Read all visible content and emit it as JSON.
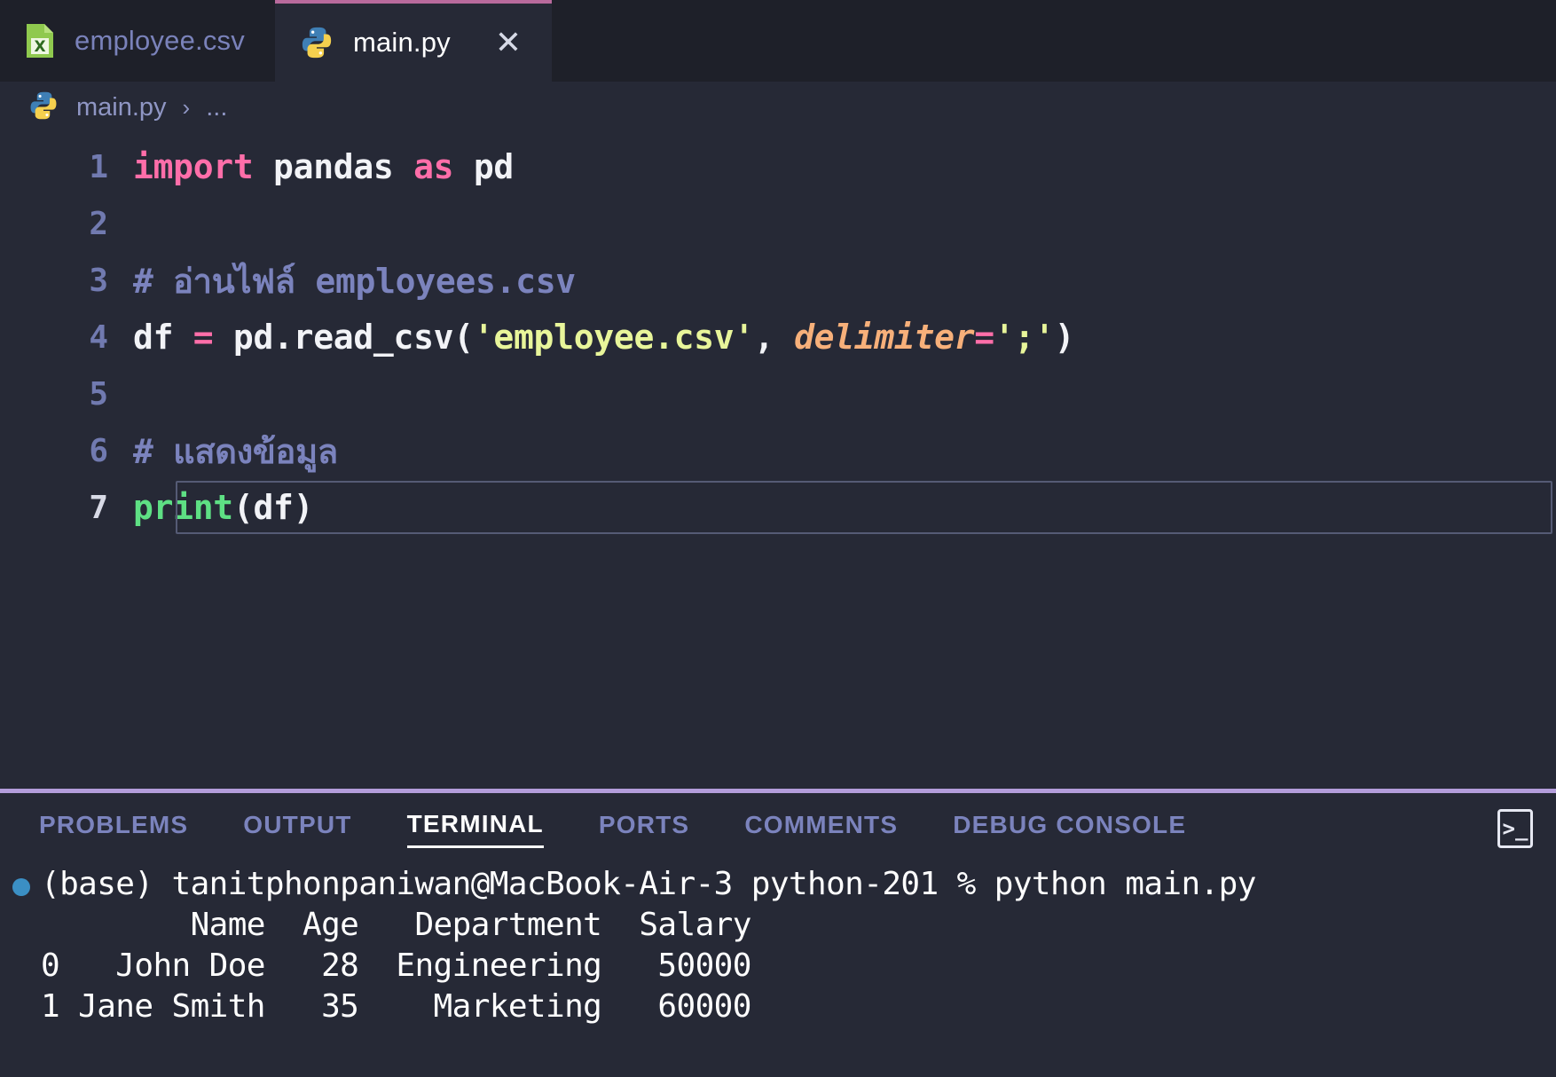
{
  "window": {
    "accent_active_tab": "#b86a9c",
    "panel_border": "#b39ddb",
    "editor_bg": "#262936",
    "tabbar_bg": "#1e2029"
  },
  "tabs": [
    {
      "label": "employee.csv",
      "icon": "csv-file-icon",
      "active": false,
      "closable": false
    },
    {
      "label": "main.py",
      "icon": "python-file-icon",
      "active": true,
      "closable": true,
      "close_glyph": "✕"
    }
  ],
  "breadcrumb": {
    "icon": "python-file-icon",
    "file": "main.py",
    "separator": "›",
    "overflow": "..."
  },
  "editor": {
    "lines": [
      {
        "number": "1",
        "current": false,
        "tokens": [
          {
            "text": "import",
            "type": "kw"
          },
          {
            "text": " pandas ",
            "type": "plain"
          },
          {
            "text": "as",
            "type": "kw"
          },
          {
            "text": " pd",
            "type": "plain"
          }
        ]
      },
      {
        "number": "2",
        "current": false,
        "tokens": []
      },
      {
        "number": "3",
        "current": false,
        "tokens": [
          {
            "text": "# อ่านไฟล์ employees.csv",
            "type": "comment"
          }
        ]
      },
      {
        "number": "4",
        "current": false,
        "tokens": [
          {
            "text": "df ",
            "type": "plain"
          },
          {
            "text": "=",
            "type": "op"
          },
          {
            "text": " pd.read_csv(",
            "type": "plain"
          },
          {
            "text": "'employee.csv'",
            "type": "string"
          },
          {
            "text": ", ",
            "type": "plain"
          },
          {
            "text": "delimiter",
            "type": "param"
          },
          {
            "text": "=",
            "type": "op"
          },
          {
            "text": "';'",
            "type": "string"
          },
          {
            "text": ")",
            "type": "plain"
          }
        ]
      },
      {
        "number": "5",
        "current": false,
        "tokens": []
      },
      {
        "number": "6",
        "current": false,
        "tokens": [
          {
            "text": "# แสดงข้อมูล",
            "type": "comment"
          }
        ]
      },
      {
        "number": "7",
        "current": true,
        "tokens": [
          {
            "text": "print",
            "type": "fn"
          },
          {
            "text": "(df)",
            "type": "plain"
          }
        ]
      }
    ]
  },
  "panel": {
    "tabs": [
      {
        "label": "PROBLEMS",
        "active": false
      },
      {
        "label": "OUTPUT",
        "active": false
      },
      {
        "label": "TERMINAL",
        "active": true
      },
      {
        "label": "PORTS",
        "active": false
      },
      {
        "label": "COMMENTS",
        "active": false
      },
      {
        "label": "DEBUG CONSOLE",
        "active": false
      }
    ],
    "actions": [
      {
        "icon": "new-terminal-icon",
        "glyph": ">_"
      }
    ]
  },
  "terminal": {
    "lines": [
      {
        "kind": "prompt",
        "bullet": true,
        "text": "(base) tanitphonpaniwan@MacBook-Air-3 python-201 % python main.py"
      },
      {
        "kind": "output",
        "bullet": false,
        "text": "        Name  Age   Department  Salary"
      },
      {
        "kind": "output",
        "bullet": false,
        "text": "0   John Doe   28  Engineering   50000"
      },
      {
        "kind": "output",
        "bullet": false,
        "text": "1 Jane Smith   35    Marketing   60000"
      }
    ],
    "dataframe": {
      "columns": [
        "Name",
        "Age",
        "Department",
        "Salary"
      ],
      "index": [
        "0",
        "1"
      ],
      "rows": [
        [
          "John Doe",
          "28",
          "Engineering",
          "50000"
        ],
        [
          "Jane Smith",
          "35",
          "Marketing",
          "60000"
        ]
      ]
    }
  }
}
